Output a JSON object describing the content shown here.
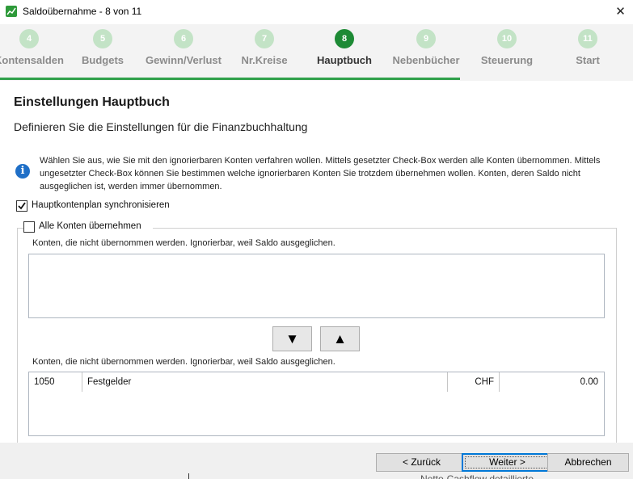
{
  "window": {
    "title": "Saldoübernahme - 8 von 11",
    "close_glyph": "✕",
    "app_icon": "chart-icon"
  },
  "steps": [
    {
      "number": "4",
      "label": "Kontensalden",
      "active": false
    },
    {
      "number": "5",
      "label": "Budgets",
      "active": false
    },
    {
      "number": "6",
      "label": "Gewinn/Verlust",
      "active": false
    },
    {
      "number": "7",
      "label": "Nr.Kreise",
      "active": false
    },
    {
      "number": "8",
      "label": "Hauptbuch",
      "active": true
    },
    {
      "number": "9",
      "label": "Nebenbücher",
      "active": false
    },
    {
      "number": "10",
      "label": "Steuerung",
      "active": false
    },
    {
      "number": "11",
      "label": "Start",
      "active": false
    }
  ],
  "page": {
    "heading": "Einstellungen Hauptbuch",
    "subheading": "Definieren Sie die Einstellungen für die Finanzbuchhaltung",
    "info_text": "Wählen Sie aus, wie Sie mit den ignorierbaren Konten verfahren wollen. Mittels gesetzter Check-Box werden alle Konten übernommen. Mittels ungesetzter Check-Box können Sie bestimmen welche ignorierbaren Konten Sie trotzdem übernehmen wollen. Konten, deren Saldo nicht ausgeglichen ist, werden immer übernommen.",
    "sync_checkbox": {
      "label": "Hauptkontenplan synchronisieren",
      "checked": true
    },
    "all_accounts_checkbox": {
      "label": "Alle Konten übernehmen",
      "checked": false
    },
    "list1_caption": "Konten, die nicht übernommen werden. Ignorierbar, weil Saldo ausgeglichen.",
    "list2_caption": "Konten, die nicht übernommen werden. Ignorierbar, weil Saldo ausgeglichen.",
    "move_down_glyph": "▼",
    "move_up_glyph": "▲",
    "list2_rows": [
      {
        "number": "1050",
        "name": "Festgelder",
        "currency": "CHF",
        "balance": "0.00"
      }
    ]
  },
  "footer": {
    "back_label": "< Zurück",
    "next_label": "Weiter >",
    "cancel_label": "Abbrechen",
    "overlap_text": "Netto-Cashflow detaillierte"
  },
  "colors": {
    "accent_green": "#1d8a35",
    "progress_green": "#2fa04a",
    "inactive_step": "#c3e3c6",
    "info_blue": "#1f6fc7"
  }
}
